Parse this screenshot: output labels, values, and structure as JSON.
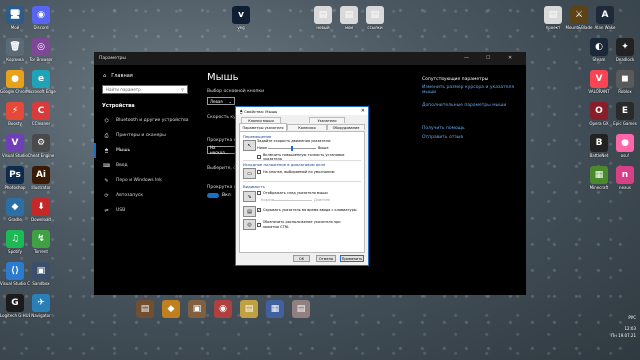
{
  "desktop": {
    "icons_left": [
      {
        "label": "Мой\nкомпьютер",
        "glyph": "🖥",
        "color": "#2d5b8a"
      },
      {
        "label": "Discord",
        "glyph": "◉",
        "color": "#5865f2"
      },
      {
        "label": "Корзина",
        "glyph": "🗑",
        "color": "#5a6a77"
      },
      {
        "label": "Tor Browser",
        "glyph": "◎",
        "color": "#7e4798"
      },
      {
        "label": "Google Chrome",
        "glyph": "●",
        "color": "#e8a21a"
      },
      {
        "label": "Microsoft Edge",
        "glyph": "e",
        "color": "#1fa3b8"
      },
      {
        "label": "Boosty",
        "glyph": "⚡",
        "color": "#e5493a"
      },
      {
        "label": "CCleaner",
        "glyph": "C",
        "color": "#d83b3b"
      },
      {
        "label": "Visual Studio",
        "glyph": "V",
        "color": "#6e3fb5"
      },
      {
        "label": "Cheat Engine",
        "glyph": "⚙",
        "color": "#4a4a4a"
      },
      {
        "label": "Photoshop",
        "glyph": "Ps",
        "color": "#0e2b4f"
      },
      {
        "label": "Illustrator",
        "glyph": "Ai",
        "color": "#3a1b06"
      },
      {
        "label": "Gradle",
        "glyph": "◆",
        "color": "#2b6fa7"
      },
      {
        "label": "Download",
        "glyph": "⬇",
        "color": "#c62828"
      },
      {
        "label": "Spotify",
        "glyph": "♫",
        "color": "#1db954"
      },
      {
        "label": "Torrent",
        "glyph": "↯",
        "color": "#3fa142"
      },
      {
        "label": "Visual Studio Code",
        "glyph": "⟨⟩",
        "color": "#2b7bd1"
      },
      {
        "label": "Sandbox",
        "glyph": "▣",
        "color": "#3b4f6b"
      },
      {
        "label": "Logitech G HUB",
        "glyph": "G",
        "color": "#1b1b1b"
      },
      {
        "label": "Navigator",
        "glyph": "✈",
        "color": "#2a7fb6"
      }
    ],
    "icons_top": [
      {
        "label": "veg",
        "glyph": "v",
        "color": "#101e33"
      },
      {
        "label": "новый\nдокумент",
        "glyph": "▤",
        "color": "#d9d9d9"
      },
      {
        "label": "мои\nкартинки",
        "glyph": "▤",
        "color": "#d9d9d9"
      },
      {
        "label": "ссылки\nдля работы",
        "glyph": "▤",
        "color": "#d9d9d9"
      },
      {
        "label": "проект\nвсе файлы",
        "glyph": "▤",
        "color": "#d9d9d9"
      }
    ],
    "icons_right": [
      {
        "label": "Mount&Blade",
        "glyph": "⚔",
        "color": "#5b4317"
      },
      {
        "label": "Alan Wake",
        "glyph": "A",
        "color": "#1e2a3a"
      },
      {
        "label": "Steam",
        "glyph": "◐",
        "color": "#1b2838"
      },
      {
        "label": "Deadlock",
        "glyph": "✦",
        "color": "#222"
      },
      {
        "label": "VALORANT",
        "glyph": "V",
        "color": "#fa4454"
      },
      {
        "label": "Roblox",
        "glyph": "◼",
        "color": "#5a5a5a"
      },
      {
        "label": "Opera GX",
        "glyph": "O",
        "color": "#8a1d2a"
      },
      {
        "label": "Epic Games",
        "glyph": "E",
        "color": "#2a2a2a"
      },
      {
        "label": "BattleNet",
        "glyph": "B",
        "color": "#222"
      },
      {
        "label": "osu!",
        "glyph": "●",
        "color": "#ff66aa"
      },
      {
        "label": "Minecraft",
        "glyph": "▦",
        "color": "#4b8a2c"
      },
      {
        "label": "nexus",
        "glyph": "n",
        "color": "#d83f87"
      }
    ],
    "icons_bottom": [
      {
        "label": "",
        "glyph": "▤",
        "color": "#705030"
      },
      {
        "label": "",
        "glyph": "◆",
        "color": "#c08020"
      },
      {
        "label": "",
        "glyph": "▣",
        "color": "#806040"
      },
      {
        "label": "",
        "glyph": "◉",
        "color": "#b04040"
      },
      {
        "label": "",
        "glyph": "▤",
        "color": "#c0a040"
      },
      {
        "label": "",
        "glyph": "▦",
        "color": "#4060a0"
      },
      {
        "label": "",
        "glyph": "▤",
        "color": "#908080"
      }
    ]
  },
  "settings": {
    "window_title": "Параметры",
    "home_label": "Главная",
    "search_placeholder": "Найти параметр",
    "section_title": "Устройства",
    "nav_items": [
      {
        "label": "Bluetooth и другие устройства",
        "icon": "⌬"
      },
      {
        "label": "Принтеры и сканеры",
        "icon": "⎙"
      },
      {
        "label": "Мышь",
        "icon": "🖱"
      },
      {
        "label": "Ввод",
        "icon": "⌨"
      },
      {
        "label": "Перо и Windows Ink",
        "icon": "✎"
      },
      {
        "label": "Автозапуск",
        "icon": "⟳"
      },
      {
        "label": "USB",
        "icon": "⇌"
      }
    ],
    "page_title": "Мышь",
    "primary_button_label": "Выбор основной кнопки",
    "primary_button_value": "Левая",
    "cursor_speed_label": "Скорость курс...",
    "scroll_label": "Прокрутка к...",
    "scroll_value": "На нескол...",
    "lines_label": "Выберите, с...",
    "inactive_label": "Прокрутка н...",
    "toggle_label": "Вкл",
    "related_title": "Сопутствующие параметры",
    "related_link": "Изменить размер курсора и указателя мыши",
    "extra_link": "Дополнительные параметры мыши",
    "help_link": "Получить помощь",
    "feedback_link": "Отправить отзыв"
  },
  "dialog": {
    "title": "Свойства: Мышь",
    "tabs_row1": [
      "Кнопки мыши",
      "Указатели"
    ],
    "tabs_row2": [
      "Параметры указателя",
      "Колесико",
      "Оборудование"
    ],
    "group_move": "Перемещение",
    "speed_text": "Задайте скорость движения указателя:",
    "slow": "Ниже",
    "fast": "Выше",
    "precision": "Включить повышенную точность установки указателя",
    "group_snap": "Исходное положение в диалоговом окне",
    "snap_text": "На кнопке, выбираемой по умолчанию",
    "group_vis": "Видимость",
    "trails": "Отображать след указателя мыши",
    "trails_short": "Короче",
    "trails_long": "Длиннее",
    "hide_typing": "Скрывать указатель во время ввода с клавиатуры",
    "show_ctrl": "Обозначить расположение указателя при нажатии CTRL",
    "ok": "ОК",
    "cancel": "Отмена",
    "apply": "Применить",
    "speed_fraction": 0.5,
    "checkboxes": {
      "precision": false,
      "snap": false,
      "trails": false,
      "hide_typing": true,
      "show_ctrl": false
    }
  },
  "tray": {
    "lang": "РУС",
    "time": "12:03",
    "date": "Пн 19.07.21"
  }
}
